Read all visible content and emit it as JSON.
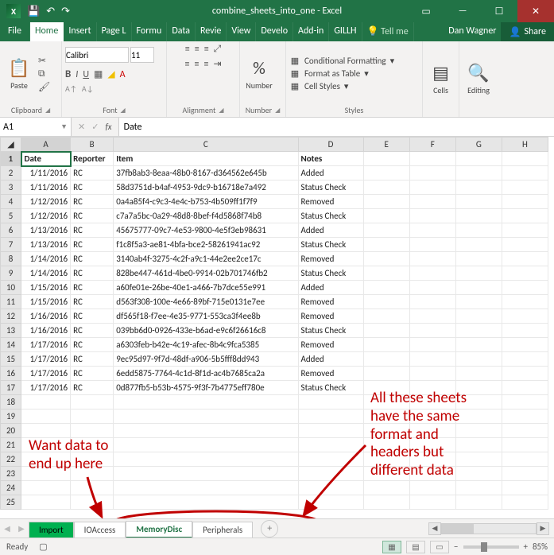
{
  "window": {
    "title": "combine_sheets_into_one - Excel"
  },
  "menutabs": {
    "file": "File",
    "home": "Home",
    "insert": "Insert",
    "page": "Page L",
    "formu": "Formu",
    "data": "Data",
    "review": "Revie",
    "view": "View",
    "devel": "Develo",
    "addin": "Add-in",
    "gillh": "GILLH",
    "tellme": "Tell me",
    "user": "Dan Wagner",
    "share": "Share"
  },
  "ribbon": {
    "clipboard": {
      "label": "Clipboard",
      "paste": "Paste"
    },
    "font": {
      "label": "Font",
      "name": "Calibri",
      "size": "11"
    },
    "alignment": {
      "label": "Alignment"
    },
    "number": {
      "label": "Number",
      "btn": "Number"
    },
    "styles": {
      "label": "Styles",
      "cond": "Conditional Formatting",
      "table": "Format as Table",
      "cell": "Cell Styles"
    },
    "cells": {
      "label": "Cells",
      "btn": "Cells"
    },
    "editing": {
      "label": "Editing",
      "btn": "Editing"
    }
  },
  "namebox": "A1",
  "formulabox": "Date",
  "headers": [
    "Date",
    "Reporter",
    "Item",
    "Notes"
  ],
  "rows": [
    {
      "d": "1/11/2016",
      "r": "RC",
      "i": "37fb8ab3-8eaa-48b0-8167-d364562e645b",
      "n": "Added"
    },
    {
      "d": "1/11/2016",
      "r": "RC",
      "i": "58d3751d-b4af-4953-9dc9-b16718e7a492",
      "n": "Status Check"
    },
    {
      "d": "1/12/2016",
      "r": "RC",
      "i": "0a4a85f4-c9c3-4e4c-b753-4b509ff1f7f9",
      "n": "Removed"
    },
    {
      "d": "1/12/2016",
      "r": "RC",
      "i": "c7a7a5bc-0a29-48d8-8bef-f4d5868f74b8",
      "n": "Status Check"
    },
    {
      "d": "1/13/2016",
      "r": "RC",
      "i": "45675777-09c7-4e53-9800-4e5f3eb98631",
      "n": "Added"
    },
    {
      "d": "1/13/2016",
      "r": "RC",
      "i": "f1c8f5a3-ae81-4bfa-bce2-58261941ac92",
      "n": "Status Check"
    },
    {
      "d": "1/14/2016",
      "r": "RC",
      "i": "3140ab4f-3275-4c2f-a9c1-44e2ee2ce17c",
      "n": "Removed"
    },
    {
      "d": "1/14/2016",
      "r": "RC",
      "i": "828be447-461d-4be0-9914-02b701746fb2",
      "n": "Status Check"
    },
    {
      "d": "1/15/2016",
      "r": "RC",
      "i": "a60fe01e-26be-40e1-a466-7b7dce55e991",
      "n": "Added"
    },
    {
      "d": "1/15/2016",
      "r": "RC",
      "i": "d563f308-100e-4e66-89bf-715e0131e7ee",
      "n": "Removed"
    },
    {
      "d": "1/16/2016",
      "r": "RC",
      "i": "df565f18-f7ee-4e35-9771-553ca3f4ee8b",
      "n": "Removed"
    },
    {
      "d": "1/16/2016",
      "r": "RC",
      "i": "039bb6d0-0926-433e-b6ad-e9c6f26616c8",
      "n": "Status Check"
    },
    {
      "d": "1/17/2016",
      "r": "RC",
      "i": "a6303feb-b42e-4c19-afec-8b4c9fca5385",
      "n": "Removed"
    },
    {
      "d": "1/17/2016",
      "r": "RC",
      "i": "9ec95d97-9f7d-48df-a906-5b5fff8dd943",
      "n": "Added"
    },
    {
      "d": "1/17/2016",
      "r": "RC",
      "i": "6edd5875-7764-4c1d-8f1d-ac4b7685ca2a",
      "n": "Removed"
    },
    {
      "d": "1/17/2016",
      "r": "RC",
      "i": "0d877fb5-b53b-4575-9f3f-7b4775eff780e",
      "n": "Status Check"
    }
  ],
  "sheets": {
    "s1": "Import",
    "s2": "IOAccess",
    "s3": "MemoryDisc",
    "s4": "Peripherals"
  },
  "status": {
    "ready": "Ready",
    "zoom": "85%"
  },
  "anno": {
    "left": "Want data to\nend up here",
    "right": "All these sheets\nhave the same\nformat and\nheaders but\ndifferent data"
  }
}
